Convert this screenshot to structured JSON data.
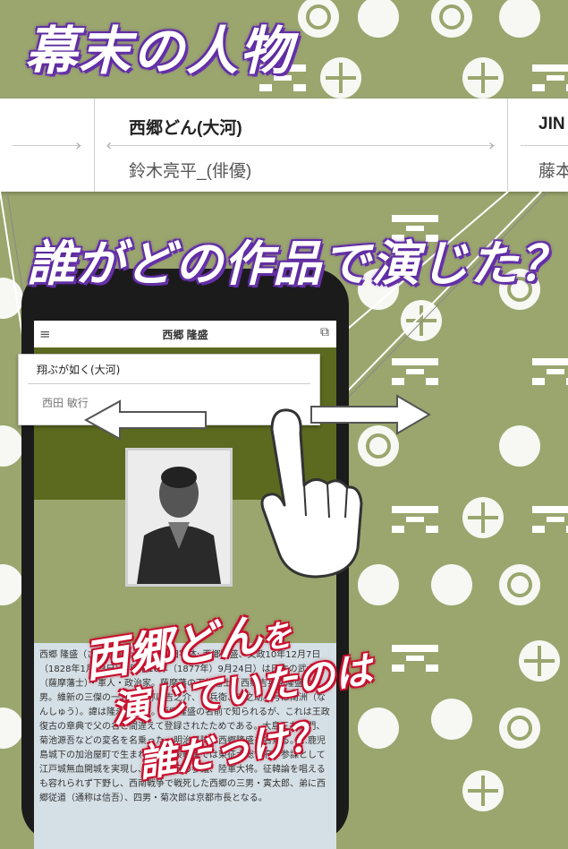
{
  "titles": {
    "top": "幕末の人物",
    "middle": "誰がどの作品で演じた？"
  },
  "carousel": {
    "cards": [
      {
        "title": "",
        "subtitle": ""
      },
      {
        "title": "西郷どん(大河)",
        "subtitle": "鈴木亮平_(俳優)"
      },
      {
        "title": "JIN",
        "subtitle": "藤本"
      }
    ]
  },
  "phone": {
    "app_title": "西郷 隆盛",
    "popup": {
      "title": "翔ぶが如く(大河)",
      "subtitle": "西田 敏行"
    },
    "bio_text": "西郷 隆盛（さいごう たかもり、旧字体: 西鄉隆盛、文政10年12月7日（1828年1月23日）- 明治10年（1877年）9月24日）は日本の武士（薩摩藩士）・軍人・政治家。薩摩藩の下級藩士・西郷吉兵衛隆盛の長男。維新の三傑の一人。通称は吉之介、吉兵衛、吉之助。号は南洲（なんしゅう）。諱は隆永、隆盛。西郷隆盛の名前で知られるが、これは王政復古の章典で父の名と間違えて登録されたためである。大島三右衛門、菊池源吾などの変名を名乗った。明治以降は西郷隆盛を名乗る。…鹿児島城下の加治屋町で生まれる。戊辰戦争では東征大総督府下参謀として江戸城無血開城を実現し、明治政府の参議、陸軍大将。征韓論を唱えるも容れられず下野し、西南戦争で戦死した西郷の三男・寅太郎、弟に西郷従道（通称は信吾）、四男・菊次郎は京都市長となる。"
  },
  "caption": {
    "line1": "西郷どん",
    "line1_particle": "を",
    "line2": "演じていたのは",
    "line3": "誰だっけ？"
  },
  "colors": {
    "background": "#9aa66e",
    "title_outline": "#6b34b0",
    "caption_outline": "#c8102e"
  }
}
